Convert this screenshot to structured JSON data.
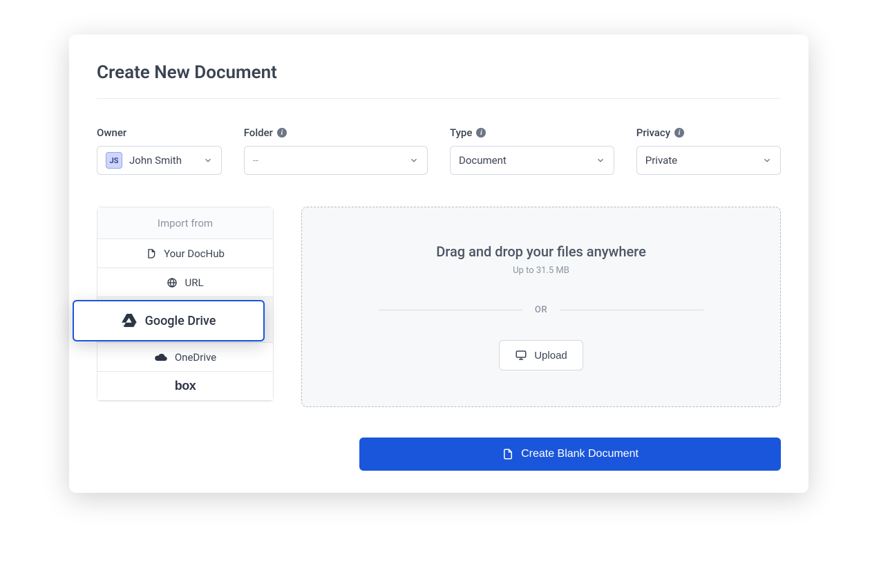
{
  "title": "Create New Document",
  "fields": {
    "owner": {
      "label": "Owner",
      "value": "John Smith",
      "avatar_initials": "JS"
    },
    "folder": {
      "label": "Folder",
      "value": "--"
    },
    "type": {
      "label": "Type",
      "value": "Document"
    },
    "privacy": {
      "label": "Privacy",
      "value": "Private"
    }
  },
  "import": {
    "header": "Import from",
    "items": {
      "dochub": "Your DocHub",
      "url": "URL",
      "googledrive": "Google Drive",
      "onedrive": "OneDrive",
      "box": "box"
    }
  },
  "dropzone": {
    "title": "Drag and drop your files anywhere",
    "subtitle": "Up to 31.5 MB",
    "or": "OR",
    "upload_label": "Upload"
  },
  "footer": {
    "create_label": "Create Blank Document"
  }
}
